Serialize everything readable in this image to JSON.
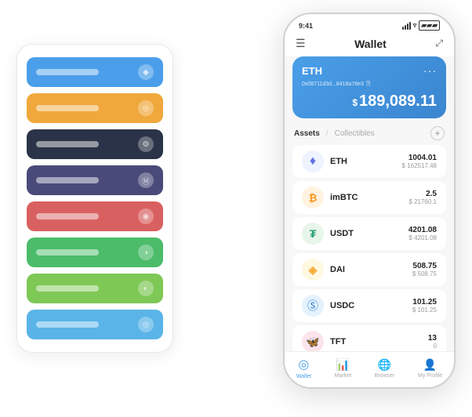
{
  "scene": {
    "leftPanel": {
      "cards": [
        {
          "id": "card-1",
          "color": "card-blue",
          "iconText": "◆"
        },
        {
          "id": "card-2",
          "color": "card-orange",
          "iconText": "◎"
        },
        {
          "id": "card-3",
          "color": "card-dark",
          "iconText": "⚙"
        },
        {
          "id": "card-4",
          "color": "card-purple",
          "iconText": "Ⓜ"
        },
        {
          "id": "card-5",
          "color": "card-red",
          "iconText": "◉"
        },
        {
          "id": "card-6",
          "color": "card-green",
          "iconText": "◑"
        },
        {
          "id": "card-7",
          "color": "card-light-green",
          "iconText": "◐"
        },
        {
          "id": "card-8",
          "color": "card-light-blue",
          "iconText": "◎"
        }
      ]
    },
    "phone": {
      "statusBar": {
        "time": "9:41",
        "icons": "▌▌▌ ▿ ▰▰▰"
      },
      "header": {
        "menuIcon": "☰",
        "title": "Wallet",
        "expandIcon": "⤢"
      },
      "ethCard": {
        "title": "ETH",
        "dots": "···",
        "address": "0x08711d3d...8418a78e3",
        "copyIcon": "⎘",
        "amount": "189,089.11",
        "dollarSign": "$"
      },
      "assetsSection": {
        "tabActive": "Assets",
        "divider": "/",
        "tabInactive": "Collectibles",
        "addIcon": "+"
      },
      "assets": [
        {
          "name": "ETH",
          "iconEmoji": "♦",
          "iconClass": "eth-icon",
          "amount": "1004.01",
          "usd": "$ 162517.48"
        },
        {
          "name": "imBTC",
          "iconEmoji": "₿",
          "iconClass": "imbtc-icon",
          "amount": "2.5",
          "usd": "$ 21760.1"
        },
        {
          "name": "USDT",
          "iconEmoji": "₮",
          "iconClass": "usdt-icon",
          "amount": "4201.08",
          "usd": "$ 4201.08"
        },
        {
          "name": "DAI",
          "iconEmoji": "◈",
          "iconClass": "dai-icon",
          "amount": "508.75",
          "usd": "$ 508.75"
        },
        {
          "name": "USDC",
          "iconEmoji": "Ⓢ",
          "iconClass": "usdc-icon",
          "amount": "101.25",
          "usd": "$ 101.25"
        },
        {
          "name": "TFT",
          "iconEmoji": "🦋",
          "iconClass": "tft-icon",
          "amount": "13",
          "usd": "0"
        }
      ],
      "bottomNav": [
        {
          "id": "wallet",
          "icon": "◎",
          "label": "Wallet",
          "active": true
        },
        {
          "id": "market",
          "icon": "📈",
          "label": "Market",
          "active": false
        },
        {
          "id": "browser",
          "icon": "⊕",
          "label": "Browser",
          "active": false
        },
        {
          "id": "profile",
          "icon": "👤",
          "label": "My Profile",
          "active": false
        }
      ]
    }
  }
}
